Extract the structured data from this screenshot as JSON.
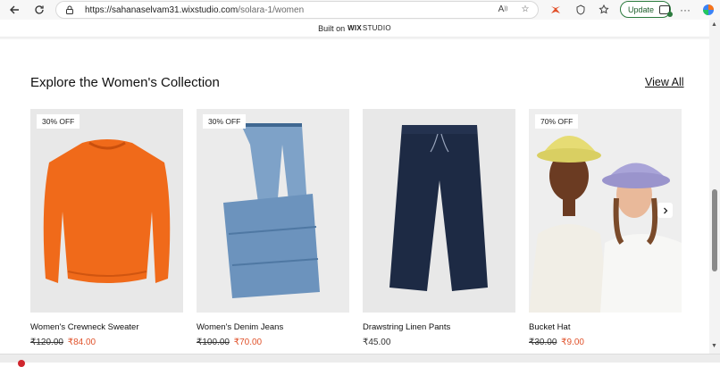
{
  "browser": {
    "url_host": "https://sahanaselvam31.wixstudio.com",
    "url_path": "/solara-1/women",
    "update_label": "Update"
  },
  "banner": {
    "built_on": "Built on",
    "wix": "WIX",
    "studio": "STUDIO"
  },
  "section": {
    "title": "Explore the Women's Collection",
    "view_all": "View All"
  },
  "products": [
    {
      "name": "Women's Crewneck Sweater",
      "badge": "30% OFF",
      "old_price": "₹120.00",
      "new_price": "₹84.00"
    },
    {
      "name": "Women's Denim Jeans",
      "badge": "30% OFF",
      "old_price": "₹100.00",
      "new_price": "₹70.00"
    },
    {
      "name": "Drawstring Linen Pants",
      "badge": "",
      "price": "₹45.00"
    },
    {
      "name": "Bucket Hat",
      "badge": "70% OFF",
      "old_price": "₹30.00",
      "new_price": "₹9.00"
    }
  ],
  "colors": {
    "sale_price": "#e0522b",
    "sweater": "#f06a1a",
    "denim": "#6c93bd",
    "linen": "#1d2a44"
  },
  "icons": [
    "back-arrow-icon",
    "refresh-icon",
    "lock-icon",
    "read-aloud-icon",
    "favorite-star-icon",
    "extension-icon",
    "favorites-icon",
    "more-icon",
    "copilot-icon",
    "chevron-right-icon"
  ]
}
